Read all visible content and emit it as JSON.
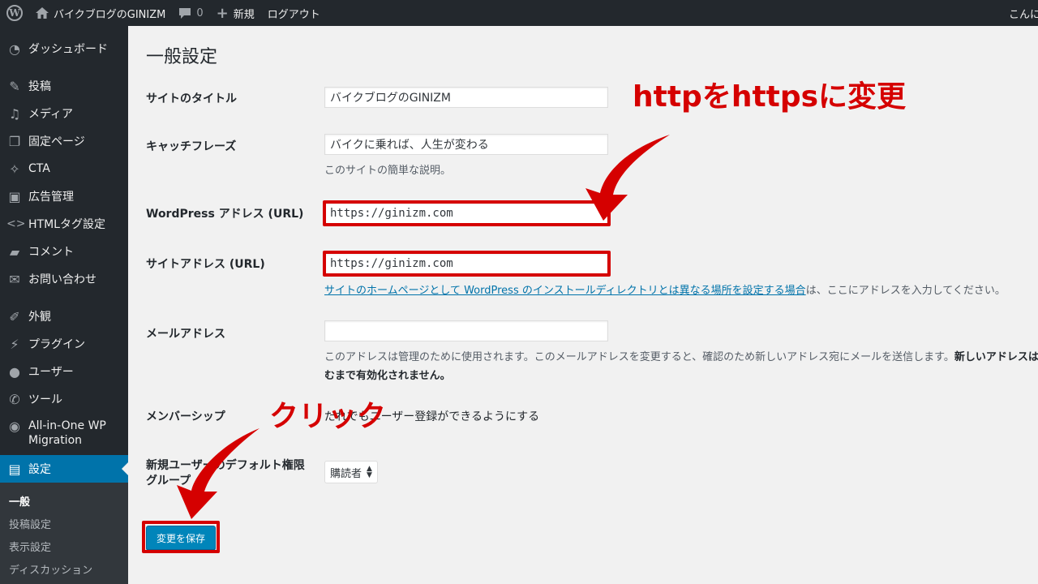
{
  "adminbar": {
    "wp_logo": "W",
    "site_name": "バイクブログのGINIZM",
    "comment_count": "0",
    "new_label": "新規",
    "logout_label": "ログアウト",
    "greeting": "こんにちは"
  },
  "sidebar": {
    "items": [
      {
        "label": "ダッシュボード",
        "icon": "dashboard-icon"
      },
      {
        "label": "投稿",
        "icon": "pin-icon"
      },
      {
        "label": "メディア",
        "icon": "media-icon"
      },
      {
        "label": "固定ページ",
        "icon": "page-icon"
      },
      {
        "label": "CTA",
        "icon": "cta-icon"
      },
      {
        "label": "広告管理",
        "icon": "ad-icon"
      },
      {
        "label": "HTMLタグ設定",
        "icon": "code-icon"
      },
      {
        "label": "コメント",
        "icon": "comment-icon"
      },
      {
        "label": "お問い合わせ",
        "icon": "mail-icon"
      },
      {
        "label": "外観",
        "icon": "brush-icon"
      },
      {
        "label": "プラグイン",
        "icon": "plugin-icon"
      },
      {
        "label": "ユーザー",
        "icon": "user-icon"
      },
      {
        "label": "ツール",
        "icon": "wrench-icon"
      },
      {
        "label": "All-in-One WP Migration",
        "icon": "migration-icon"
      },
      {
        "label": "設定",
        "icon": "settings-icon"
      }
    ],
    "submenu": [
      "一般",
      "投稿設定",
      "表示設定",
      "ディスカッション"
    ]
  },
  "main": {
    "title": "一般設定",
    "site_title_label": "サイトのタイトル",
    "site_title_value": "バイクブログのGINIZM",
    "tagline_label": "キャッチフレーズ",
    "tagline_value": "バイクに乗れば、人生が変わる",
    "tagline_desc": "このサイトの簡単な説明。",
    "wp_address_label": "WordPress アドレス (URL)",
    "wp_address_value": "https://ginizm.com",
    "site_address_label": "サイトアドレス (URL)",
    "site_address_value": "https://ginizm.com",
    "site_address_link": "サイトのホームページとして WordPress のインストールディレクトリとは異なる場所を設定する場合",
    "site_address_desc_rest": "は、ここにアドレスを入力してください。",
    "email_label": "メールアドレス",
    "email_value": "",
    "email_desc": "このアドレスは管理のために使用されます。このメールアドレスを変更すると、確認のため新しいアドレス宛にメールを送信します。",
    "email_desc_bold1": "新しいアドレスは確認が済",
    "email_desc_bold2": "むまで有効化されません。",
    "membership_label": "メンバーシップ",
    "membership_text": "だれでもユーザー登録ができるようにする",
    "default_role_label_1": "新規ユーザーのデフォルト権限",
    "default_role_label_2": "グループ",
    "default_role_value": "購読者",
    "save_button": "変更を保存"
  },
  "annotations": {
    "https_note": "httpをhttpsに変更",
    "click_note": "クリック"
  },
  "colors": {
    "adminbar_bg": "#23282d",
    "accent": "#0073aa",
    "annotation_red": "#d50000"
  }
}
